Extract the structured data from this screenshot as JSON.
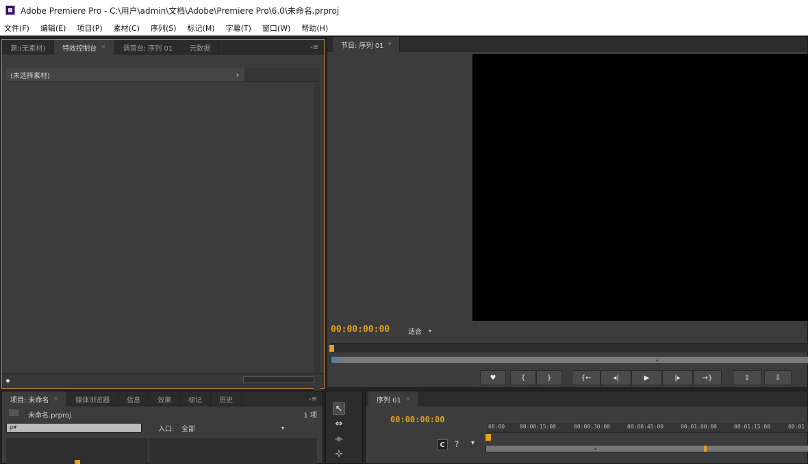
{
  "window": {
    "title": "Adobe Premiere Pro - C:\\用户\\admin\\文档\\Adobe\\Premiere Pro\\6.0\\未命名.prproj"
  },
  "menu": [
    "文件(F)",
    "编辑(E)",
    "项目(P)",
    "素材(C)",
    "序列(S)",
    "标记(M)",
    "字幕(T)",
    "窗口(W)",
    "帮助(H)"
  ],
  "effects_panel": {
    "tabs": [
      {
        "label": "源:(无素材)",
        "active": false
      },
      {
        "label": "特效控制台",
        "active": true
      },
      {
        "label": "调音台: 序列 01",
        "active": false
      },
      {
        "label": "元数据",
        "active": false
      }
    ],
    "header": "(未选择素材)",
    "header_arrow": "›",
    "menu_icon": "-≡"
  },
  "program_monitor": {
    "tab": "节目: 序列 01",
    "timecode": "00:00:00:00",
    "fit": "适合",
    "transport": [
      {
        "name": "marker-button",
        "glyph": "♥"
      },
      {
        "name": "mark-in-button",
        "glyph": "{"
      },
      {
        "name": "mark-out-button",
        "glyph": "}"
      },
      {
        "name": "go-to-in-button",
        "glyph": "{←"
      },
      {
        "name": "step-back-button",
        "glyph": "◂|"
      },
      {
        "name": "play-button",
        "glyph": "▶"
      },
      {
        "name": "step-forward-button",
        "glyph": "|▸"
      },
      {
        "name": "go-to-out-button",
        "glyph": "→}"
      },
      {
        "name": "lift-button",
        "glyph": "⇪"
      },
      {
        "name": "extract-button",
        "glyph": "⇩"
      }
    ]
  },
  "project_panel": {
    "tabs": [
      {
        "label": "项目: 未命名",
        "active": true
      },
      {
        "label": "媒体浏览器",
        "active": false
      },
      {
        "label": "信息",
        "active": false
      },
      {
        "label": "效果",
        "active": false
      },
      {
        "label": "标记",
        "active": false
      },
      {
        "label": "历史",
        "active": false
      }
    ],
    "file_name": "未命名.prproj",
    "item_count": "1 项",
    "search_placeholder": "ρ▾",
    "inpoint_label": "入口:",
    "inpoint_value": "全部",
    "menu_icon": "-≡"
  },
  "tools": [
    "selection-tool",
    "track-select-tool",
    "ripple-edit-tool",
    "rolling-edit-tool"
  ],
  "timeline": {
    "tab": "序列 01",
    "timecode": "00:00:00:00",
    "ticks": [
      "00:00",
      "00:00:15:00",
      "00:00:30:00",
      "00:00:45:00",
      "00:01:00:00",
      "00:01:15:00",
      "00:01"
    ]
  }
}
